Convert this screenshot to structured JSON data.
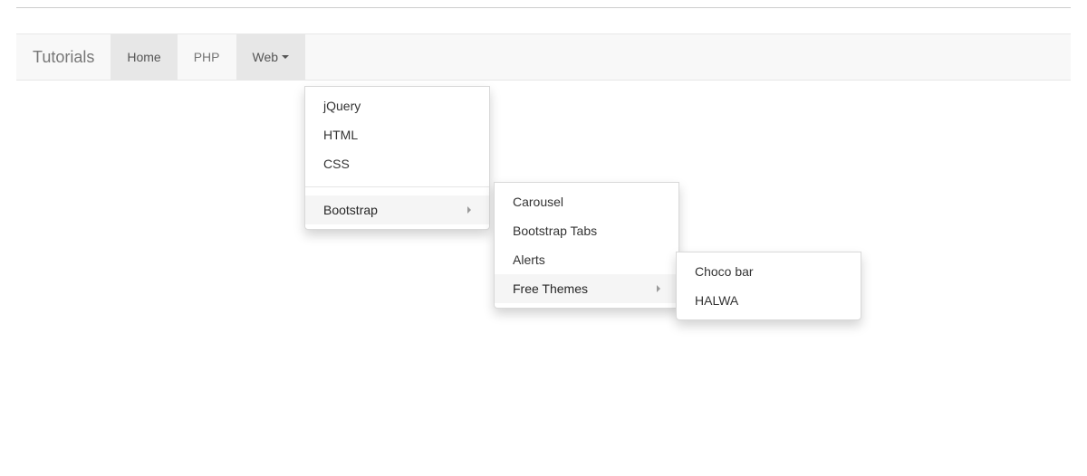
{
  "navbar": {
    "brand": "Tutorials",
    "items": [
      {
        "label": "Home",
        "active": true
      },
      {
        "label": "PHP"
      },
      {
        "label": "Web",
        "open": true,
        "hasDropdown": true
      }
    ]
  },
  "dropdown_level1": {
    "items": [
      {
        "label": "jQuery"
      },
      {
        "label": "HTML"
      },
      {
        "label": "CSS"
      }
    ],
    "divider": true,
    "afterDivider": [
      {
        "label": "Bootstrap",
        "hasSubmenu": true,
        "highlighted": true
      }
    ]
  },
  "dropdown_level2": {
    "items": [
      {
        "label": "Carousel"
      },
      {
        "label": "Bootstrap Tabs"
      },
      {
        "label": "Alerts"
      },
      {
        "label": "Free Themes",
        "hasSubmenu": true,
        "highlighted": true
      }
    ]
  },
  "dropdown_level3": {
    "items": [
      {
        "label": "Choco bar"
      },
      {
        "label": "HALWA"
      }
    ]
  }
}
